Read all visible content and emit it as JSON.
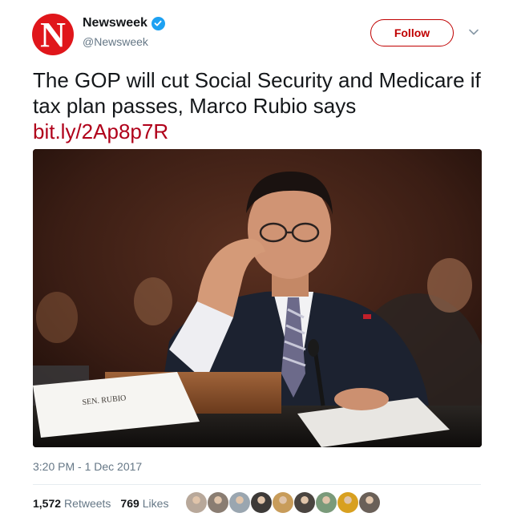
{
  "author": {
    "avatar_letter": "N",
    "display_name": "Newsweek",
    "handle": "@Newsweek",
    "brand_color": "#e0161b",
    "verified": true
  },
  "follow_label": "Follow",
  "tweet": {
    "text": "The GOP will cut Social Security and Medicare if tax plan passes, Marco Rubio says",
    "link": "bit.ly/2Ap8p7R",
    "link_color": "#b0001a"
  },
  "media": {
    "nameplate_text": "SEN. RUBIO"
  },
  "timestamp": "3:20 PM - 1 Dec 2017",
  "stats": {
    "retweets_count": "1,572",
    "retweets_label": "Retweets",
    "likes_count": "769",
    "likes_label": "Likes"
  },
  "liker_avatar_colors": [
    "#b8a89a",
    "#8a7d72",
    "#9aa6b0",
    "#3d3a38",
    "#c89c5a",
    "#4a4440",
    "#7a9a7a",
    "#d8a020",
    "#6a6058"
  ]
}
